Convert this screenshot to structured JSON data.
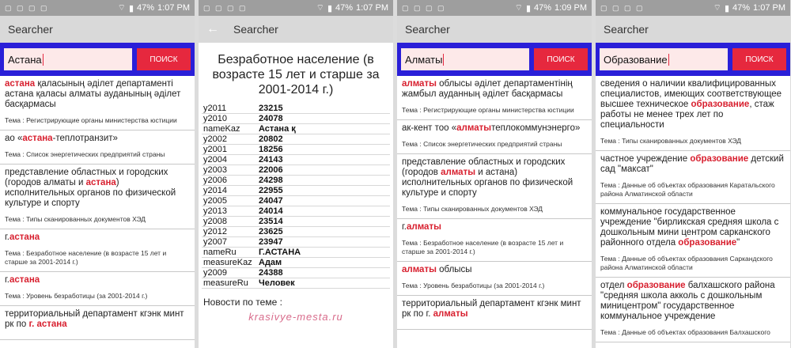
{
  "status": {
    "s1": {
      "time": "1:07 PM",
      "battery": "47%"
    },
    "s2": {
      "time": "1:07 PM",
      "battery": "47%"
    },
    "s3": {
      "time": "1:09 PM",
      "battery": "47%"
    },
    "s4": {
      "time": "1:07 PM",
      "battery": "47%"
    }
  },
  "app_title": "Searcher",
  "search_button": "ПОИСК",
  "screen1": {
    "query": "Астана",
    "results": [
      {
        "text": [
          {
            "t": "астана",
            "h": true
          },
          {
            "t": " қаласының әділет департаменті астана қаласы алматы ауданының әділет басқармасы",
            "h": false
          }
        ],
        "topic": "Тема : Регистрирующие органы министерства юстиции"
      },
      {
        "text": [
          {
            "t": "ао «",
            "h": false
          },
          {
            "t": "астана",
            "h": true
          },
          {
            "t": "-теплотранзит»",
            "h": false
          }
        ],
        "topic": "Тема : Список энергетических предприятий страны"
      },
      {
        "text": [
          {
            "t": "представление областных и городских (городов алматы и ",
            "h": false
          },
          {
            "t": "астана",
            "h": true
          },
          {
            "t": ") исполнительных органов по физической культуре и спорту",
            "h": false
          }
        ],
        "topic": "Тема : Типы сканированных документов ХЭД"
      },
      {
        "text": [
          {
            "t": "г.",
            "h": false
          },
          {
            "t": "астана",
            "h": true
          }
        ],
        "topic": "Тема : Безработное население (в возрасте 15 лет и старше за 2001-2014 г.)"
      },
      {
        "text": [
          {
            "t": "г.",
            "h": false
          },
          {
            "t": "астана",
            "h": true
          }
        ],
        "topic": "Тема : Уровень безработицы (за 2001-2014 г.)"
      },
      {
        "text": [
          {
            "t": "территориальный департамент кгэнк минт рк по ",
            "h": false
          },
          {
            "t": "г. астана",
            "h": true
          }
        ],
        "topic": ""
      }
    ]
  },
  "screen2": {
    "title": "Безработное население (в возрасте 15 лет и старше за 2001-2014 г.)",
    "rows": [
      {
        "k": "y2011",
        "v": "23215"
      },
      {
        "k": "y2010",
        "v": "24078"
      },
      {
        "k": "nameKaz",
        "v": "Астана қ"
      },
      {
        "k": "y2002",
        "v": "20802"
      },
      {
        "k": "y2001",
        "v": "18256"
      },
      {
        "k": "y2004",
        "v": "24143"
      },
      {
        "k": "y2003",
        "v": "22006"
      },
      {
        "k": "y2006",
        "v": "24298"
      },
      {
        "k": "y2014",
        "v": "22955"
      },
      {
        "k": "y2005",
        "v": "24047"
      },
      {
        "k": "y2013",
        "v": "24014"
      },
      {
        "k": "y2008",
        "v": "23514"
      },
      {
        "k": "y2012",
        "v": "23625"
      },
      {
        "k": "y2007",
        "v": "23947"
      },
      {
        "k": "nameRu",
        "v": "Г.АСТАНА"
      },
      {
        "k": "measureKaz",
        "v": "Адам"
      },
      {
        "k": "y2009",
        "v": "24388"
      },
      {
        "k": "measureRu",
        "v": "Человек"
      }
    ],
    "news_label": "Новости по теме :",
    "watermark": "krasivye-mesta.ru"
  },
  "screen3": {
    "query": "Алматы",
    "results": [
      {
        "text": [
          {
            "t": "алматы",
            "h": true
          },
          {
            "t": " облысы әділет департаментінің жамбыл ауданның әділет басқармасы",
            "h": false
          }
        ],
        "topic": "Тема : Регистрирующие органы министерства юстиции"
      },
      {
        "text": [
          {
            "t": "ак-кент тоо «",
            "h": false
          },
          {
            "t": "алматы",
            "h": true
          },
          {
            "t": "теплокоммунэнерго»",
            "h": false
          }
        ],
        "topic": "Тема : Список энергетических предприятий страны"
      },
      {
        "text": [
          {
            "t": "представление областных и городских (городов ",
            "h": false
          },
          {
            "t": "алматы",
            "h": true
          },
          {
            "t": " и астана) исполнительных органов по физической культуре и спорту",
            "h": false
          }
        ],
        "topic": "Тема : Типы сканированных документов ХЭД"
      },
      {
        "text": [
          {
            "t": "г.",
            "h": false
          },
          {
            "t": "алматы",
            "h": true
          }
        ],
        "topic": "Тема : Безработное население (в возрасте 15 лет и старше за 2001-2014 г.)"
      },
      {
        "text": [
          {
            "t": "алматы",
            "h": true
          },
          {
            "t": " облысы",
            "h": false
          }
        ],
        "topic": "Тема : Уровень безработицы (за 2001-2014 г.)"
      },
      {
        "text": [
          {
            "t": "территориальный департамент кгэнк минт рк по г. ",
            "h": false
          },
          {
            "t": "алматы",
            "h": true
          }
        ],
        "topic": ""
      }
    ]
  },
  "screen4": {
    "query": "Образование",
    "results": [
      {
        "text": [
          {
            "t": "сведения о наличии квалифицированных специалистов, имеющих соответствующее высшее техническое ",
            "h": false
          },
          {
            "t": "образование",
            "h": true
          },
          {
            "t": ", стаж работы не менее трех лет по специальности",
            "h": false
          }
        ],
        "topic": "Тема : Типы сканированных документов ХЭД"
      },
      {
        "text": [
          {
            "t": "частное учреждение ",
            "h": false
          },
          {
            "t": "образование",
            "h": true
          },
          {
            "t": "  детский сад \"максат\"",
            "h": false
          }
        ],
        "topic": "Тема : Данные об объектах образования Каратальского района Алматинской области"
      },
      {
        "text": [
          {
            "t": "коммунальное государственное учреждение \"бирликская средняя школа с дошкольным мини центром сарканского районного отдела ",
            "h": false
          },
          {
            "t": "образование",
            "h": true
          },
          {
            "t": "\"",
            "h": false
          }
        ],
        "topic": "Тема : Данные об объектах образования Саркандского района Алматинской области"
      },
      {
        "text": [
          {
            "t": "отдел ",
            "h": false
          },
          {
            "t": "образование",
            "h": true
          },
          {
            "t": " балхашского района \"средняя школа акколь с дошкольным миницентром\" государственное коммунальное учреждение",
            "h": false
          }
        ],
        "topic": "Тема : Данные об объектах образования Балхашского"
      }
    ]
  }
}
